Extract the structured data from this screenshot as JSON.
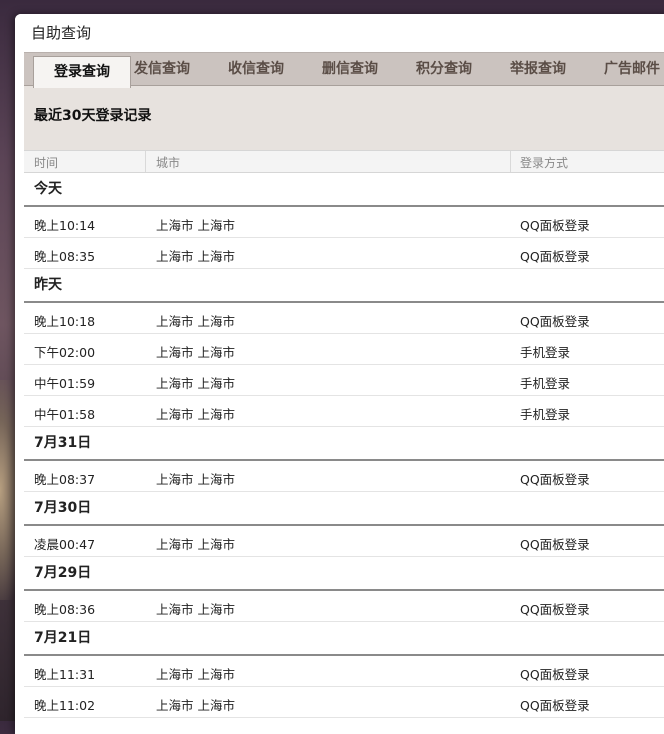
{
  "window": {
    "title": "自助查询"
  },
  "tabs": [
    {
      "label": "登录查询",
      "active": true
    },
    {
      "label": "发信查询"
    },
    {
      "label": "收信查询"
    },
    {
      "label": "删信查询"
    },
    {
      "label": "积分查询"
    },
    {
      "label": "举报查询"
    },
    {
      "label": "广告邮件"
    }
  ],
  "panel": {
    "title": "最近30天登录记录"
  },
  "columns": {
    "time": "时间",
    "city": "城市",
    "method": "登录方式"
  },
  "groups": [
    {
      "label": "今天",
      "rows": [
        {
          "time": "晚上10:14",
          "city": "上海市 上海市",
          "method": "QQ面板登录"
        },
        {
          "time": "晚上08:35",
          "city": "上海市 上海市",
          "method": "QQ面板登录"
        }
      ]
    },
    {
      "label": "昨天",
      "rows": [
        {
          "time": "晚上10:18",
          "city": "上海市 上海市",
          "method": "QQ面板登录"
        },
        {
          "time": "下午02:00",
          "city": "上海市 上海市",
          "method": "手机登录"
        },
        {
          "time": "中午01:59",
          "city": "上海市 上海市",
          "method": "手机登录"
        },
        {
          "time": "中午01:58",
          "city": "上海市 上海市",
          "method": "手机登录"
        }
      ]
    },
    {
      "label": "7月31日",
      "rows": [
        {
          "time": "晚上08:37",
          "city": "上海市 上海市",
          "method": "QQ面板登录"
        }
      ]
    },
    {
      "label": "7月30日",
      "rows": [
        {
          "time": "凌晨00:47",
          "city": "上海市 上海市",
          "method": "QQ面板登录"
        }
      ]
    },
    {
      "label": "7月29日",
      "rows": [
        {
          "time": "晚上08:36",
          "city": "上海市 上海市",
          "method": "QQ面板登录"
        }
      ]
    },
    {
      "label": "7月21日",
      "rows": [
        {
          "time": "晚上11:31",
          "city": "上海市 上海市",
          "method": "QQ面板登录"
        },
        {
          "time": "晚上11:02",
          "city": "上海市 上海市",
          "method": "QQ面板登录"
        }
      ]
    }
  ]
}
